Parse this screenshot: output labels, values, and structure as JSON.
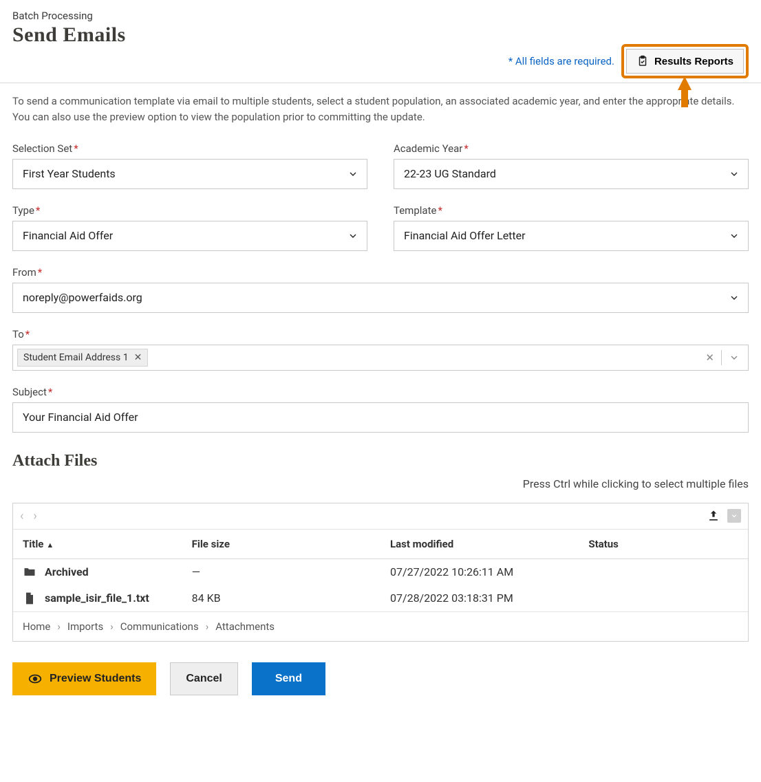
{
  "header": {
    "eyebrow": "Batch Processing",
    "title": "Send Emails",
    "required_note": "* All fields are required.",
    "results_button": "Results Reports"
  },
  "intro": "To send a communication template via email to multiple students, select a student population, an associated academic year, and enter the appropriate details. You can also use the preview option to view the population prior to committing the update.",
  "fields": {
    "selection_set": {
      "label": "Selection Set",
      "value": "First Year Students"
    },
    "academic_year": {
      "label": "Academic Year",
      "value": "22-23 UG Standard"
    },
    "type": {
      "label": "Type",
      "value": "Financial Aid Offer"
    },
    "template": {
      "label": "Template",
      "value": "Financial Aid Offer Letter"
    },
    "from": {
      "label": "From",
      "value": "noreply@powerfaids.org"
    },
    "to": {
      "label": "To",
      "chip": "Student Email Address 1"
    },
    "subject": {
      "label": "Subject",
      "value": "Your Financial Aid Offer"
    }
  },
  "attach": {
    "heading": "Attach Files",
    "hint": "Press Ctrl while clicking to select multiple files",
    "columns": {
      "title": "Title",
      "size": "File size",
      "modified": "Last modified",
      "status": "Status"
    },
    "rows": [
      {
        "kind": "folder",
        "title": "Archived",
        "size": "—",
        "modified": "07/27/2022 10:26:11 AM",
        "status": ""
      },
      {
        "kind": "file",
        "title": "sample_isir_file_1.txt",
        "size": "84 KB",
        "modified": "07/28/2022 03:18:31 PM",
        "status": ""
      }
    ],
    "breadcrumbs": [
      "Home",
      "Imports",
      "Communications",
      "Attachments"
    ]
  },
  "actions": {
    "preview": "Preview Students",
    "cancel": "Cancel",
    "send": "Send"
  }
}
